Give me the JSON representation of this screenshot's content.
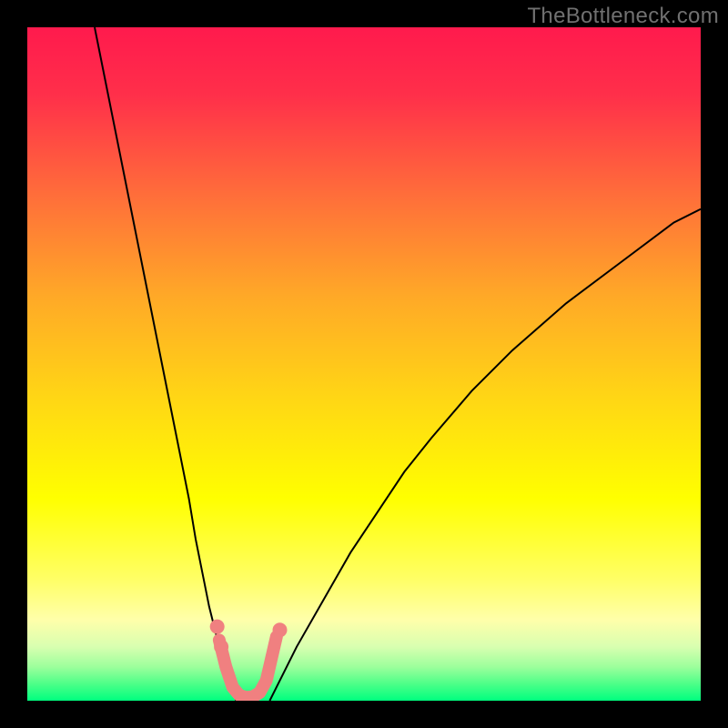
{
  "watermark": "TheBottleneck.com",
  "chart_data": {
    "type": "line",
    "title": "",
    "xlabel": "",
    "ylabel": "",
    "xlim": [
      0,
      100
    ],
    "ylim": [
      0,
      100
    ],
    "background_gradient": {
      "stops": [
        {
          "offset": 0.0,
          "color": "#ff1a4d"
        },
        {
          "offset": 0.1,
          "color": "#ff2f4a"
        },
        {
          "offset": 0.25,
          "color": "#ff6e3a"
        },
        {
          "offset": 0.4,
          "color": "#ffa927"
        },
        {
          "offset": 0.55,
          "color": "#ffd615"
        },
        {
          "offset": 0.7,
          "color": "#ffff00"
        },
        {
          "offset": 0.82,
          "color": "#ffff66"
        },
        {
          "offset": 0.88,
          "color": "#ffffaa"
        },
        {
          "offset": 0.92,
          "color": "#d8ffb0"
        },
        {
          "offset": 0.95,
          "color": "#9cff9c"
        },
        {
          "offset": 0.975,
          "color": "#4dff88"
        },
        {
          "offset": 1.0,
          "color": "#00ff7f"
        }
      ]
    },
    "series": [
      {
        "name": "left-branch",
        "stroke": "#000000",
        "x": [
          10,
          12,
          14,
          16,
          18,
          20,
          22,
          24,
          25,
          26,
          27,
          28,
          29,
          30,
          31
        ],
        "y": [
          100,
          90,
          80,
          70,
          60,
          50,
          40,
          30,
          24,
          19,
          14,
          10,
          6,
          3,
          0
        ]
      },
      {
        "name": "right-branch",
        "stroke": "#000000",
        "x": [
          36,
          38,
          40,
          44,
          48,
          52,
          56,
          60,
          66,
          72,
          80,
          88,
          96,
          100
        ],
        "y": [
          0,
          4,
          8,
          15,
          22,
          28,
          34,
          39,
          46,
          52,
          59,
          65,
          71,
          73
        ]
      },
      {
        "name": "valley-marker",
        "stroke": "#f08080",
        "x": [
          28.5,
          29.5,
          30.5,
          31.5,
          32.5,
          33.5,
          34.5,
          35.5,
          37.0
        ],
        "y": [
          9.0,
          5.0,
          2.0,
          0.8,
          0.5,
          0.6,
          1.2,
          3.0,
          9.5
        ]
      }
    ],
    "valley_dots": {
      "color": "#f08080",
      "points": [
        {
          "x": 28.2,
          "y": 11.0
        },
        {
          "x": 28.8,
          "y": 8.0
        },
        {
          "x": 37.5,
          "y": 10.5
        }
      ]
    }
  }
}
